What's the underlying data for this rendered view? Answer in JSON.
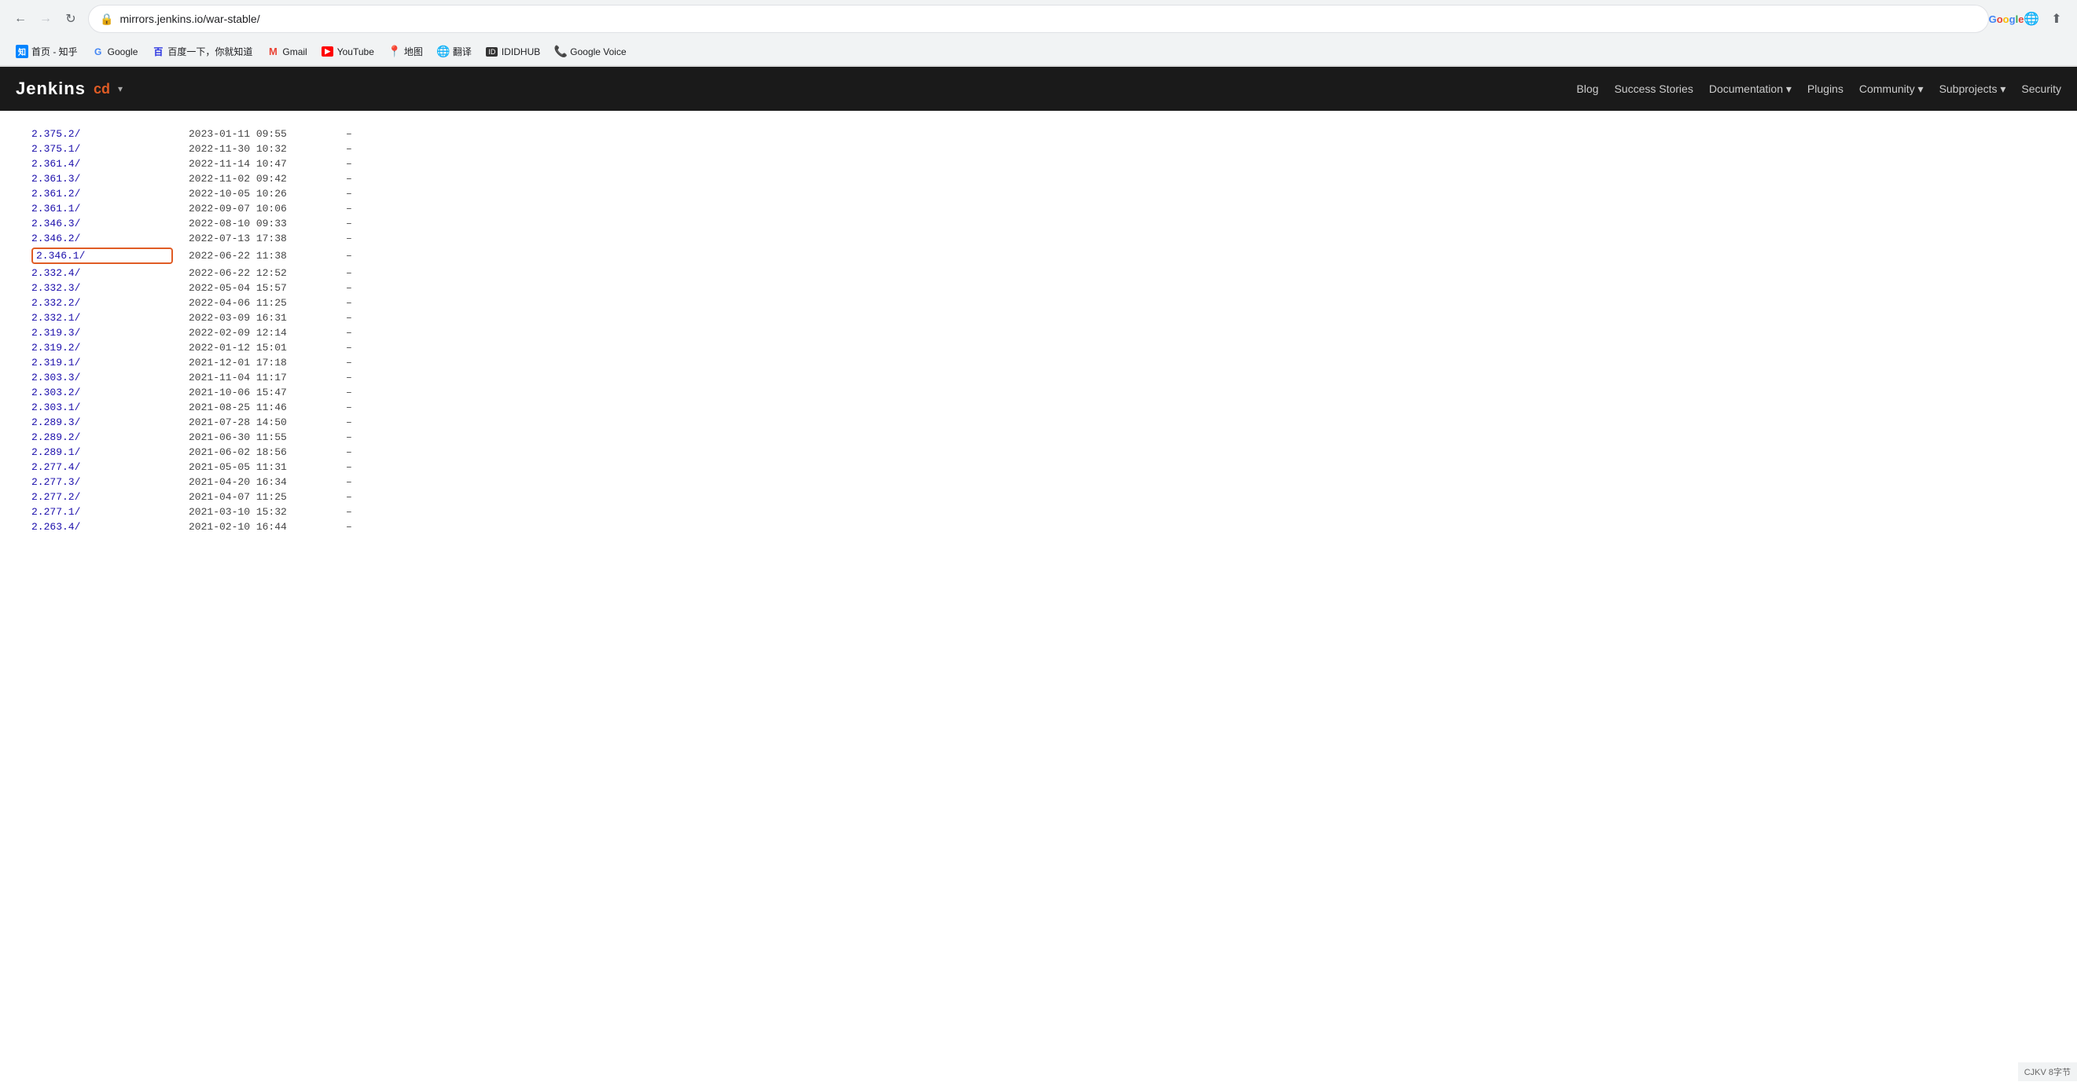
{
  "browser": {
    "url": "mirrors.jenkins.io/war-stable/",
    "back_disabled": false,
    "forward_disabled": true
  },
  "bookmarks": [
    {
      "id": "zhihu",
      "label": "首页 - 知乎",
      "icon_type": "zhihu"
    },
    {
      "id": "google",
      "label": "Google",
      "icon_type": "google"
    },
    {
      "id": "baidu",
      "label": "百度一下，你就知道",
      "icon_type": "baidu"
    },
    {
      "id": "gmail",
      "label": "Gmail",
      "icon_type": "gmail"
    },
    {
      "id": "youtube",
      "label": "YouTube",
      "icon_type": "youtube"
    },
    {
      "id": "maps",
      "label": "地图",
      "icon_type": "maps"
    },
    {
      "id": "translate",
      "label": "翻译",
      "icon_type": "translate"
    },
    {
      "id": "ididhub",
      "label": "IDIDHUB",
      "icon_type": "ididhub"
    },
    {
      "id": "google-voice",
      "label": "Google Voice",
      "icon_type": "google-voice"
    }
  ],
  "nav": {
    "logo": "Jenkins",
    "cd_badge": "cd",
    "links": [
      {
        "id": "blog",
        "label": "Blog",
        "has_dropdown": false
      },
      {
        "id": "success-stories",
        "label": "Success Stories",
        "has_dropdown": false
      },
      {
        "id": "documentation",
        "label": "Documentation",
        "has_dropdown": true
      },
      {
        "id": "plugins",
        "label": "Plugins",
        "has_dropdown": false
      },
      {
        "id": "community",
        "label": "Community",
        "has_dropdown": true
      },
      {
        "id": "subprojects",
        "label": "Subprojects",
        "has_dropdown": true
      },
      {
        "id": "security",
        "label": "Security",
        "has_dropdown": false
      }
    ]
  },
  "files": [
    {
      "name": "2.375.2/",
      "date": "2023-01-11 09:55",
      "size": "–",
      "highlighted": false
    },
    {
      "name": "2.375.1/",
      "date": "2022-11-30 10:32",
      "size": "–",
      "highlighted": false
    },
    {
      "name": "2.361.4/",
      "date": "2022-11-14 10:47",
      "size": "–",
      "highlighted": false
    },
    {
      "name": "2.361.3/",
      "date": "2022-11-02 09:42",
      "size": "–",
      "highlighted": false
    },
    {
      "name": "2.361.2/",
      "date": "2022-10-05 10:26",
      "size": "–",
      "highlighted": false
    },
    {
      "name": "2.361.1/",
      "date": "2022-09-07 10:06",
      "size": "–",
      "highlighted": false
    },
    {
      "name": "2.346.3/",
      "date": "2022-08-10 09:33",
      "size": "–",
      "highlighted": false
    },
    {
      "name": "2.346.2/",
      "date": "2022-07-13 17:38",
      "size": "–",
      "highlighted": false
    },
    {
      "name": "2.346.1/",
      "date": "2022-06-22 11:38",
      "size": "–",
      "highlighted": true
    },
    {
      "name": "2.332.4/",
      "date": "2022-06-22 12:52",
      "size": "–",
      "highlighted": false
    },
    {
      "name": "2.332.3/",
      "date": "2022-05-04 15:57",
      "size": "–",
      "highlighted": false
    },
    {
      "name": "2.332.2/",
      "date": "2022-04-06 11:25",
      "size": "–",
      "highlighted": false
    },
    {
      "name": "2.332.1/",
      "date": "2022-03-09 16:31",
      "size": "–",
      "highlighted": false
    },
    {
      "name": "2.319.3/",
      "date": "2022-02-09 12:14",
      "size": "–",
      "highlighted": false
    },
    {
      "name": "2.319.2/",
      "date": "2022-01-12 15:01",
      "size": "–",
      "highlighted": false
    },
    {
      "name": "2.319.1/",
      "date": "2021-12-01 17:18",
      "size": "–",
      "highlighted": false
    },
    {
      "name": "2.303.3/",
      "date": "2021-11-04 11:17",
      "size": "–",
      "highlighted": false
    },
    {
      "name": "2.303.2/",
      "date": "2021-10-06 15:47",
      "size": "–",
      "highlighted": false
    },
    {
      "name": "2.303.1/",
      "date": "2021-08-25 11:46",
      "size": "–",
      "highlighted": false
    },
    {
      "name": "2.289.3/",
      "date": "2021-07-28 14:50",
      "size": "–",
      "highlighted": false
    },
    {
      "name": "2.289.2/",
      "date": "2021-06-30 11:55",
      "size": "–",
      "highlighted": false
    },
    {
      "name": "2.289.1/",
      "date": "2021-06-02 18:56",
      "size": "–",
      "highlighted": false
    },
    {
      "name": "2.277.4/",
      "date": "2021-05-05 11:31",
      "size": "–",
      "highlighted": false
    },
    {
      "name": "2.277.3/",
      "date": "2021-04-20 16:34",
      "size": "–",
      "highlighted": false
    },
    {
      "name": "2.277.2/",
      "date": "2021-04-07 11:25",
      "size": "–",
      "highlighted": false
    },
    {
      "name": "2.277.1/",
      "date": "2021-03-10 15:32",
      "size": "–",
      "highlighted": false
    },
    {
      "name": "2.263.4/",
      "date": "2021-02-10 16:44",
      "size": "–",
      "highlighted": false
    }
  ],
  "footer": {
    "text": "CJKV 8字节"
  }
}
